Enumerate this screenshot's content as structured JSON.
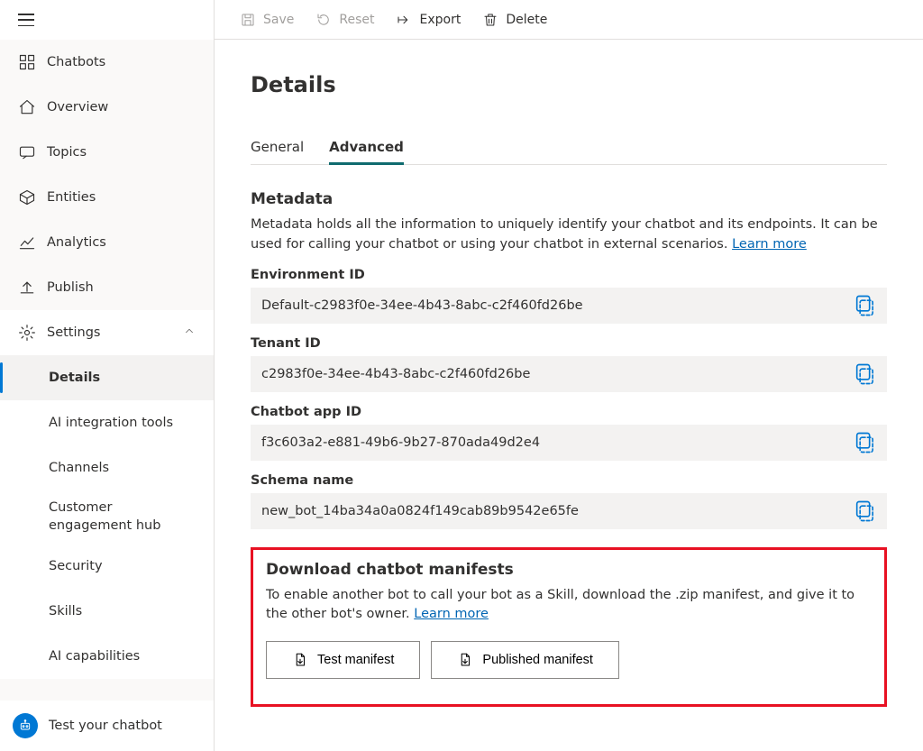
{
  "sidebar": {
    "top": "Chatbots",
    "items": [
      {
        "label": "Overview"
      },
      {
        "label": "Topics"
      },
      {
        "label": "Entities"
      },
      {
        "label": "Analytics"
      },
      {
        "label": "Publish"
      },
      {
        "label": "Settings"
      }
    ],
    "settings_children": [
      {
        "label": "Details",
        "active": true
      },
      {
        "label": "AI integration tools"
      },
      {
        "label": "Channels"
      },
      {
        "label": "Customer engagement hub"
      },
      {
        "label": "Security"
      },
      {
        "label": "Skills"
      },
      {
        "label": "AI capabilities"
      }
    ],
    "bottom": "Test your chatbot"
  },
  "toolbar": {
    "save": "Save",
    "reset": "Reset",
    "export": "Export",
    "delete": "Delete"
  },
  "page": {
    "title": "Details",
    "tabs": {
      "general": "General",
      "advanced": "Advanced"
    },
    "metadata": {
      "title": "Metadata",
      "desc": "Metadata holds all the information to uniquely identify your chatbot and its endpoints. It can be used for calling your chatbot or using your chatbot in external scenarios. ",
      "learn_more": "Learn more",
      "fields": [
        {
          "label": "Environment ID",
          "value": "Default-c2983f0e-34ee-4b43-8abc-c2f460fd26be"
        },
        {
          "label": "Tenant ID",
          "value": "c2983f0e-34ee-4b43-8abc-c2f460fd26be"
        },
        {
          "label": "Chatbot app ID",
          "value": "f3c603a2-e881-49b6-9b27-870ada49d2e4"
        },
        {
          "label": "Schema name",
          "value": "new_bot_14ba34a0a0824f149cab89b9542e65fe"
        }
      ]
    },
    "manifest": {
      "title": "Download chatbot manifests",
      "desc": "To enable another bot to call your bot as a Skill, download the .zip manifest, and give it to the other bot's owner. ",
      "learn_more": "Learn more",
      "test_btn": "Test manifest",
      "publish_btn": "Published manifest"
    }
  }
}
